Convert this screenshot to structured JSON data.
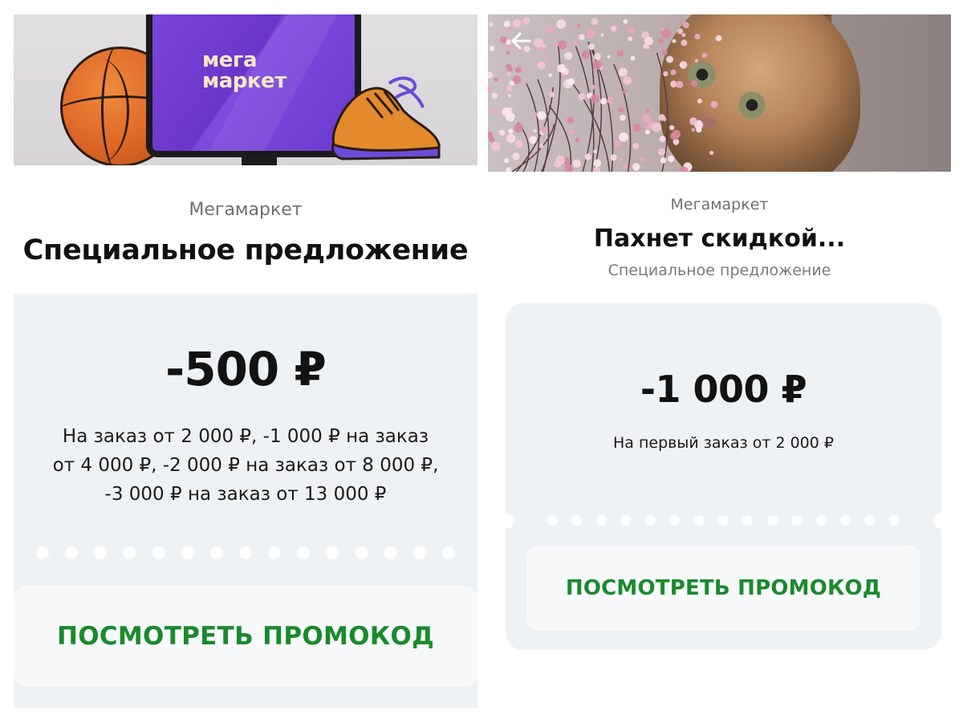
{
  "left_card": {
    "brand": "Мегамаркет",
    "title": "Специальное предложение",
    "hero_logo": "мега маркет",
    "amount": "-500 ₽",
    "description_lines": [
      "На заказ от 2 000 ₽, -1 000 ₽ на заказ",
      "от 4 000 ₽, -2 000 ₽ на заказ от 8 000 ₽,",
      "-3 000 ₽ на заказ от 13 000 ₽"
    ],
    "button_label": "ПОСМОТРЕТЬ ПРОМОКОД",
    "divider_dot_count": 15
  },
  "right_card": {
    "brand": "Мегамаркет",
    "title": "Пахнет скидкой...",
    "subtitle": "Специальное предложение",
    "amount": "-1 000 ₽",
    "description": "На первый заказ от 2 000 ₽",
    "button_label": "ПОСМОТРЕТЬ ПРОМОКОД",
    "divider_dot_count": 15,
    "back_icon": "back-arrow-icon"
  },
  "colors": {
    "accent_green": "#1a8a2d",
    "coupon_bg": "#eff2f5",
    "button_bg": "#f8f9fb",
    "logo_purple": "#7a45d8"
  }
}
